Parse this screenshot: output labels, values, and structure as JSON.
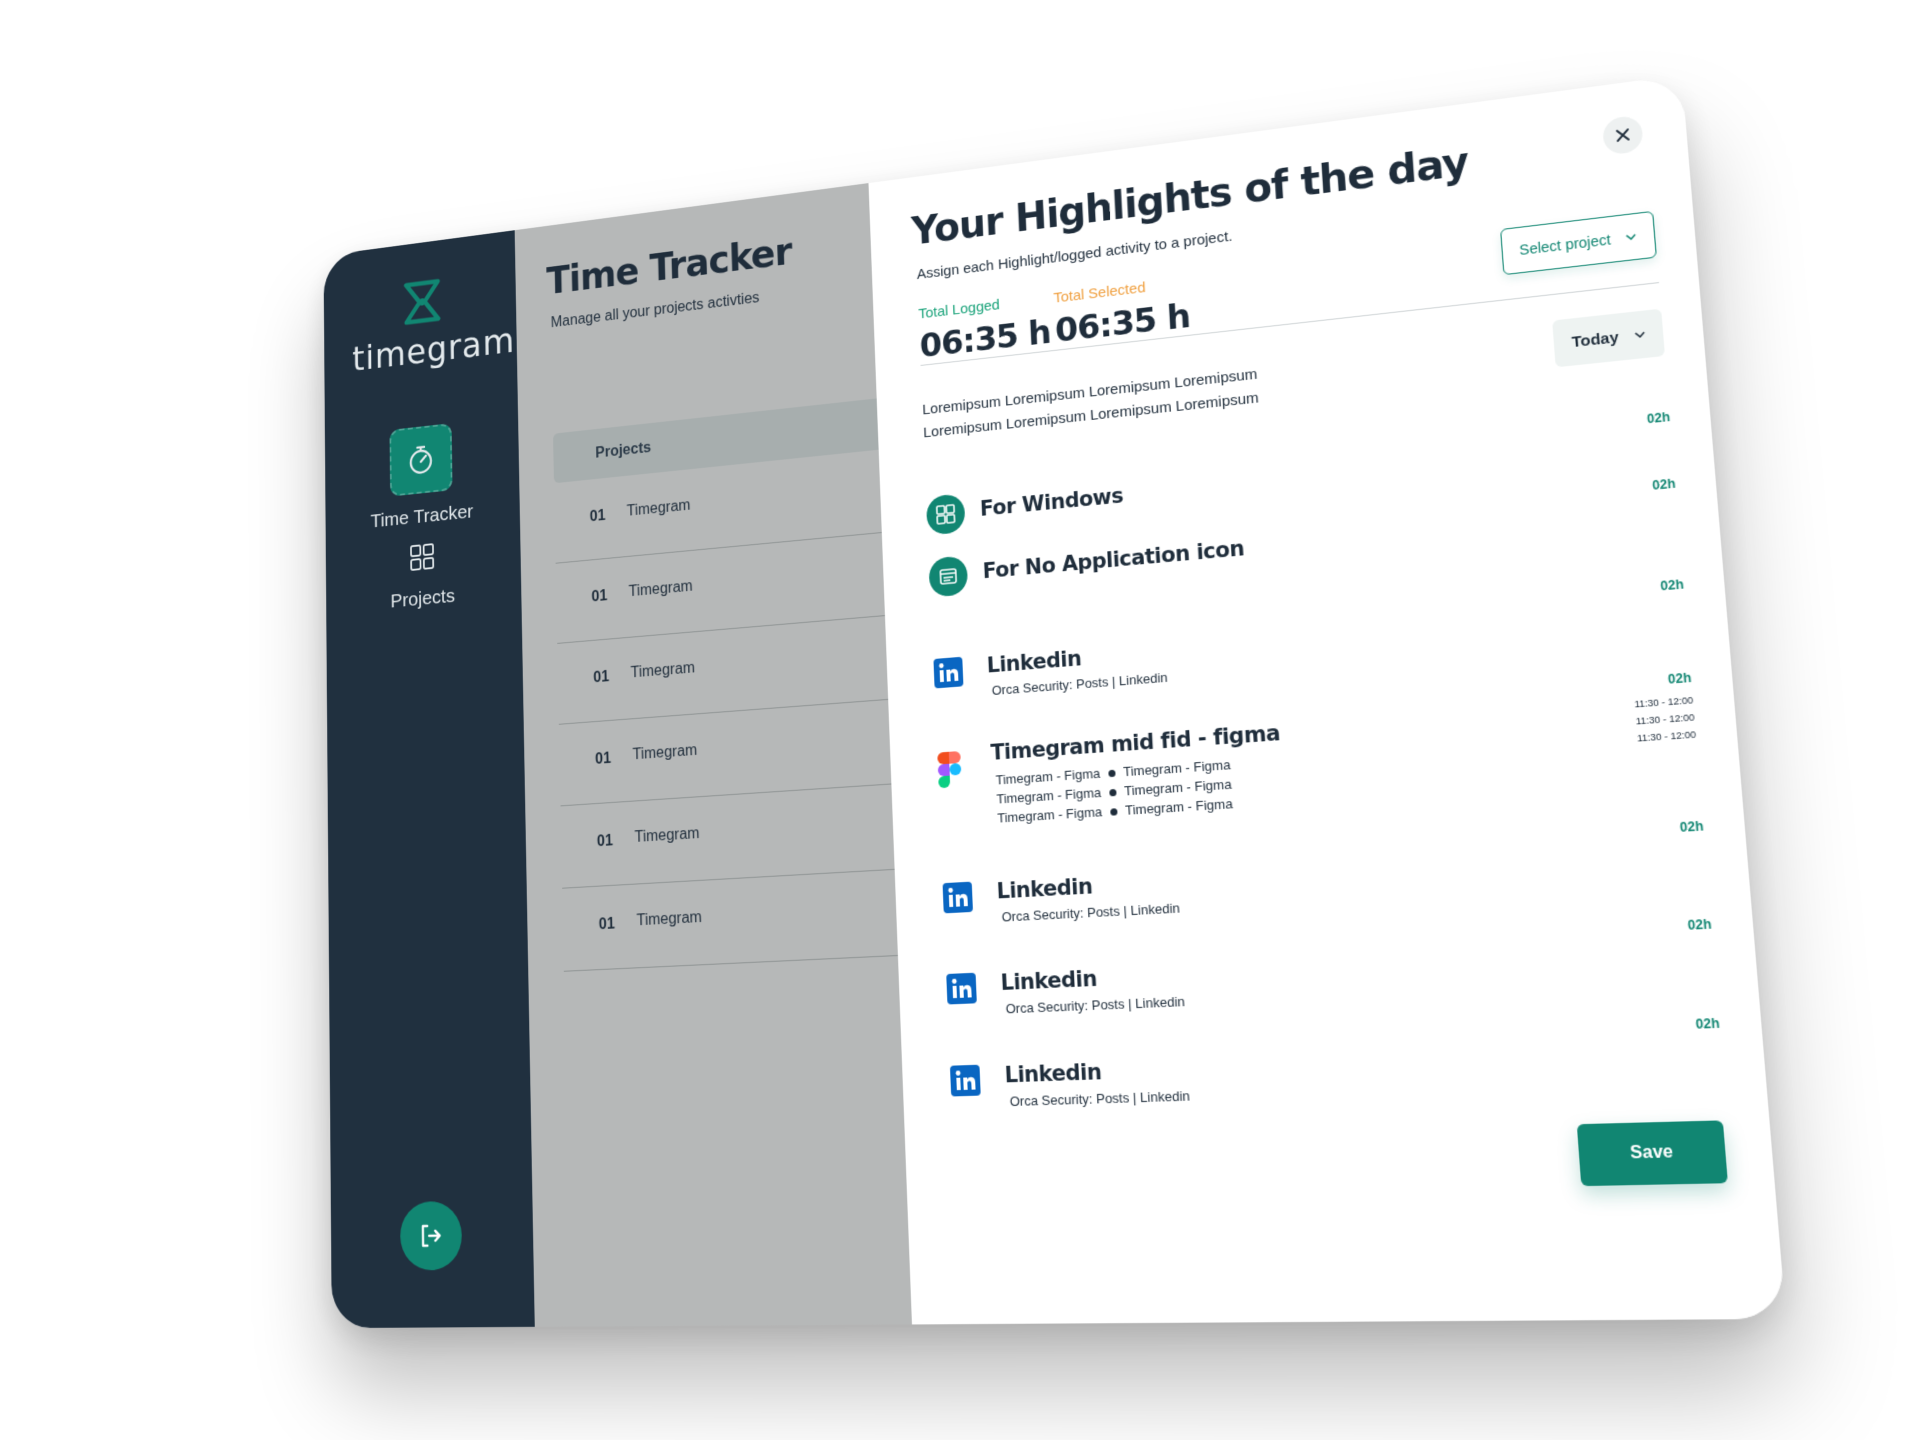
{
  "brand": {
    "name": "timegram"
  },
  "sidebar": {
    "items": [
      {
        "label": "Time Tracker",
        "icon": "stopwatch-icon",
        "active": true
      },
      {
        "label": "Projects",
        "icon": "grid-icon",
        "active": false
      }
    ],
    "logout_icon": "logout-icon"
  },
  "background_page": {
    "title": "Time Tracker",
    "subtitle": "Manage all your projects activties",
    "table_header": "Projects",
    "rows": [
      {
        "num": "01",
        "name": "Timegram"
      },
      {
        "num": "01",
        "name": "Timegram"
      },
      {
        "num": "01",
        "name": "Timegram"
      },
      {
        "num": "01",
        "name": "Timegram"
      },
      {
        "num": "01",
        "name": "Timegram"
      },
      {
        "num": "01",
        "name": "Timegram"
      }
    ]
  },
  "modal": {
    "title": "Your Highlights of  the day",
    "subtitle": "Assign each Highlight/logged activity to a project.",
    "stats": {
      "logged_label": "Total Logged",
      "logged_value": "06:35 h",
      "selected_label": "Total Selected",
      "selected_value": "06:35 h"
    },
    "select_project": "Select project",
    "description_line1": "Loremipsum Loremipsum Loremipsum Loremipsum",
    "description_line2": "Loremipsum Loremipsum Loremipsum Loremipsum",
    "filter": "Today",
    "activities": [
      {
        "name": "For Windows",
        "icon": "windows-icon",
        "duration": "02h"
      },
      {
        "name": "For No Application icon",
        "icon": "app-window-icon",
        "duration": "02h"
      },
      {
        "name": "Linkedin",
        "sub": "Orca Security: Posts | Linkedin",
        "icon": "linkedin-icon",
        "duration": "02h"
      },
      {
        "name": "Timegram mid fid - figma",
        "icon": "figma-icon",
        "duration": "02h",
        "items": [
          "Timegram - Figma",
          "Timegram - Figma",
          "Timegram - Figma",
          "Timegram - Figma",
          "Timegram - Figma",
          "Timegram - Figma"
        ],
        "times": [
          "11:30 - 12:00",
          "11:30 - 12:00",
          "11:30 - 12:00"
        ]
      },
      {
        "name": "Linkedin",
        "sub": "Orca Security: Posts | Linkedin",
        "icon": "linkedin-icon",
        "duration": "02h"
      },
      {
        "name": "Linkedin",
        "sub": "Orca Security: Posts | Linkedin",
        "icon": "linkedin-icon",
        "duration": "02h"
      },
      {
        "name": "Linkedin",
        "sub": "Orca Security: Posts | Linkedin",
        "icon": "linkedin-icon",
        "duration": "02h"
      }
    ],
    "save_label": "Save"
  },
  "colors": {
    "sidebar": "#20303f",
    "accent": "#118672",
    "logged": "#1aa37a",
    "selected": "#f0a040",
    "text": "#1f2d3b",
    "overlay": "#b6b8b8"
  }
}
